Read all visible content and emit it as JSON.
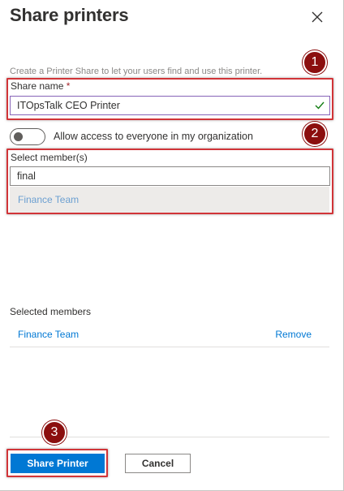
{
  "panel": {
    "title": "Share printers",
    "description": "Create a Printer Share to let your users find and use this printer."
  },
  "share_name": {
    "label": "Share name",
    "required_marker": "*",
    "value": "ITOpsTalk CEO Printer"
  },
  "access_toggle": {
    "label": "Allow access to everyone in my organization",
    "state": "off"
  },
  "select_members": {
    "label": "Select member(s)",
    "value": "final",
    "suggestions": [
      "Finance Team"
    ]
  },
  "selected_members": {
    "label": "Selected members",
    "items": [
      {
        "name": "Finance Team",
        "action": "Remove"
      }
    ]
  },
  "footer": {
    "primary_label": "Share Printer",
    "secondary_label": "Cancel"
  },
  "annotations": {
    "badges": [
      "1",
      "2",
      "3"
    ],
    "color": "#8b0e0e",
    "highlight_color": "#d13438"
  },
  "colors": {
    "accent": "#0078d4",
    "valid_border": "#8764b8",
    "check": "#107c10"
  }
}
